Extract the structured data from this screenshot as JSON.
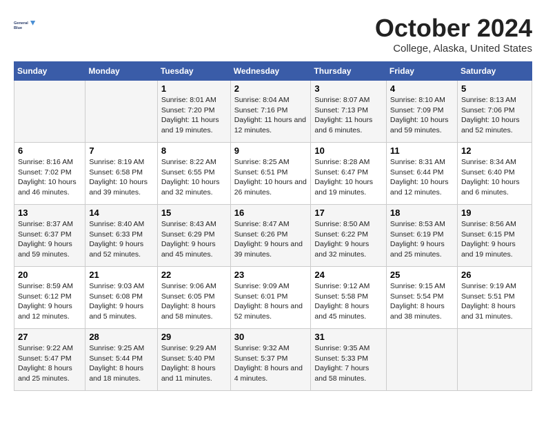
{
  "header": {
    "logo_line1": "General",
    "logo_line2": "Blue",
    "title": "October 2024",
    "subtitle": "College, Alaska, United States"
  },
  "days_of_week": [
    "Sunday",
    "Monday",
    "Tuesday",
    "Wednesday",
    "Thursday",
    "Friday",
    "Saturday"
  ],
  "weeks": [
    [
      {
        "day": "",
        "sunrise": "",
        "sunset": "",
        "daylight": ""
      },
      {
        "day": "",
        "sunrise": "",
        "sunset": "",
        "daylight": ""
      },
      {
        "day": "1",
        "sunrise": "Sunrise: 8:01 AM",
        "sunset": "Sunset: 7:20 PM",
        "daylight": "Daylight: 11 hours and 19 minutes."
      },
      {
        "day": "2",
        "sunrise": "Sunrise: 8:04 AM",
        "sunset": "Sunset: 7:16 PM",
        "daylight": "Daylight: 11 hours and 12 minutes."
      },
      {
        "day": "3",
        "sunrise": "Sunrise: 8:07 AM",
        "sunset": "Sunset: 7:13 PM",
        "daylight": "Daylight: 11 hours and 6 minutes."
      },
      {
        "day": "4",
        "sunrise": "Sunrise: 8:10 AM",
        "sunset": "Sunset: 7:09 PM",
        "daylight": "Daylight: 10 hours and 59 minutes."
      },
      {
        "day": "5",
        "sunrise": "Sunrise: 8:13 AM",
        "sunset": "Sunset: 7:06 PM",
        "daylight": "Daylight: 10 hours and 52 minutes."
      }
    ],
    [
      {
        "day": "6",
        "sunrise": "Sunrise: 8:16 AM",
        "sunset": "Sunset: 7:02 PM",
        "daylight": "Daylight: 10 hours and 46 minutes."
      },
      {
        "day": "7",
        "sunrise": "Sunrise: 8:19 AM",
        "sunset": "Sunset: 6:58 PM",
        "daylight": "Daylight: 10 hours and 39 minutes."
      },
      {
        "day": "8",
        "sunrise": "Sunrise: 8:22 AM",
        "sunset": "Sunset: 6:55 PM",
        "daylight": "Daylight: 10 hours and 32 minutes."
      },
      {
        "day": "9",
        "sunrise": "Sunrise: 8:25 AM",
        "sunset": "Sunset: 6:51 PM",
        "daylight": "Daylight: 10 hours and 26 minutes."
      },
      {
        "day": "10",
        "sunrise": "Sunrise: 8:28 AM",
        "sunset": "Sunset: 6:47 PM",
        "daylight": "Daylight: 10 hours and 19 minutes."
      },
      {
        "day": "11",
        "sunrise": "Sunrise: 8:31 AM",
        "sunset": "Sunset: 6:44 PM",
        "daylight": "Daylight: 10 hours and 12 minutes."
      },
      {
        "day": "12",
        "sunrise": "Sunrise: 8:34 AM",
        "sunset": "Sunset: 6:40 PM",
        "daylight": "Daylight: 10 hours and 6 minutes."
      }
    ],
    [
      {
        "day": "13",
        "sunrise": "Sunrise: 8:37 AM",
        "sunset": "Sunset: 6:37 PM",
        "daylight": "Daylight: 9 hours and 59 minutes."
      },
      {
        "day": "14",
        "sunrise": "Sunrise: 8:40 AM",
        "sunset": "Sunset: 6:33 PM",
        "daylight": "Daylight: 9 hours and 52 minutes."
      },
      {
        "day": "15",
        "sunrise": "Sunrise: 8:43 AM",
        "sunset": "Sunset: 6:29 PM",
        "daylight": "Daylight: 9 hours and 45 minutes."
      },
      {
        "day": "16",
        "sunrise": "Sunrise: 8:47 AM",
        "sunset": "Sunset: 6:26 PM",
        "daylight": "Daylight: 9 hours and 39 minutes."
      },
      {
        "day": "17",
        "sunrise": "Sunrise: 8:50 AM",
        "sunset": "Sunset: 6:22 PM",
        "daylight": "Daylight: 9 hours and 32 minutes."
      },
      {
        "day": "18",
        "sunrise": "Sunrise: 8:53 AM",
        "sunset": "Sunset: 6:19 PM",
        "daylight": "Daylight: 9 hours and 25 minutes."
      },
      {
        "day": "19",
        "sunrise": "Sunrise: 8:56 AM",
        "sunset": "Sunset: 6:15 PM",
        "daylight": "Daylight: 9 hours and 19 minutes."
      }
    ],
    [
      {
        "day": "20",
        "sunrise": "Sunrise: 8:59 AM",
        "sunset": "Sunset: 6:12 PM",
        "daylight": "Daylight: 9 hours and 12 minutes."
      },
      {
        "day": "21",
        "sunrise": "Sunrise: 9:03 AM",
        "sunset": "Sunset: 6:08 PM",
        "daylight": "Daylight: 9 hours and 5 minutes."
      },
      {
        "day": "22",
        "sunrise": "Sunrise: 9:06 AM",
        "sunset": "Sunset: 6:05 PM",
        "daylight": "Daylight: 8 hours and 58 minutes."
      },
      {
        "day": "23",
        "sunrise": "Sunrise: 9:09 AM",
        "sunset": "Sunset: 6:01 PM",
        "daylight": "Daylight: 8 hours and 52 minutes."
      },
      {
        "day": "24",
        "sunrise": "Sunrise: 9:12 AM",
        "sunset": "Sunset: 5:58 PM",
        "daylight": "Daylight: 8 hours and 45 minutes."
      },
      {
        "day": "25",
        "sunrise": "Sunrise: 9:15 AM",
        "sunset": "Sunset: 5:54 PM",
        "daylight": "Daylight: 8 hours and 38 minutes."
      },
      {
        "day": "26",
        "sunrise": "Sunrise: 9:19 AM",
        "sunset": "Sunset: 5:51 PM",
        "daylight": "Daylight: 8 hours and 31 minutes."
      }
    ],
    [
      {
        "day": "27",
        "sunrise": "Sunrise: 9:22 AM",
        "sunset": "Sunset: 5:47 PM",
        "daylight": "Daylight: 8 hours and 25 minutes."
      },
      {
        "day": "28",
        "sunrise": "Sunrise: 9:25 AM",
        "sunset": "Sunset: 5:44 PM",
        "daylight": "Daylight: 8 hours and 18 minutes."
      },
      {
        "day": "29",
        "sunrise": "Sunrise: 9:29 AM",
        "sunset": "Sunset: 5:40 PM",
        "daylight": "Daylight: 8 hours and 11 minutes."
      },
      {
        "day": "30",
        "sunrise": "Sunrise: 9:32 AM",
        "sunset": "Sunset: 5:37 PM",
        "daylight": "Daylight: 8 hours and 4 minutes."
      },
      {
        "day": "31",
        "sunrise": "Sunrise: 9:35 AM",
        "sunset": "Sunset: 5:33 PM",
        "daylight": "Daylight: 7 hours and 58 minutes."
      },
      {
        "day": "",
        "sunrise": "",
        "sunset": "",
        "daylight": ""
      },
      {
        "day": "",
        "sunrise": "",
        "sunset": "",
        "daylight": ""
      }
    ]
  ]
}
